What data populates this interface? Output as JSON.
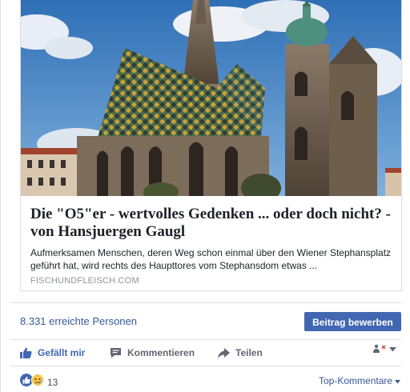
{
  "preview": {
    "headline": "Die \"O5\"er - wertvolles Gedenken ... oder doch nicht? - von Hansjuergen Gaugl",
    "description": "Aufmerksamen Menschen, deren Weg schon einmal über den Wiener Stephansplatz geführt hat, wird rechts des Haupttores vom Stephansdom etwas ...",
    "domain": "FISCHUNDFLEISCH.COM"
  },
  "insights": {
    "reach_text": "8.331 erreichte Personen",
    "promote_label": "Beitrag bewerben"
  },
  "actions": {
    "like_label": "Gefällt mir",
    "comment_label": "Kommentieren",
    "share_label": "Teilen"
  },
  "reactions": {
    "count": "13",
    "top_comments_label": "Top-Kommentare"
  },
  "colors": {
    "brand_blue": "#4267b2",
    "link_blue": "#365899",
    "muted_gray": "#606770"
  },
  "icons": [
    "thumbs-up-icon",
    "comment-icon",
    "share-arrow-icon",
    "audience-selector-icon",
    "like-reaction-icon",
    "sad-reaction-icon",
    "caret-down-icon"
  ]
}
